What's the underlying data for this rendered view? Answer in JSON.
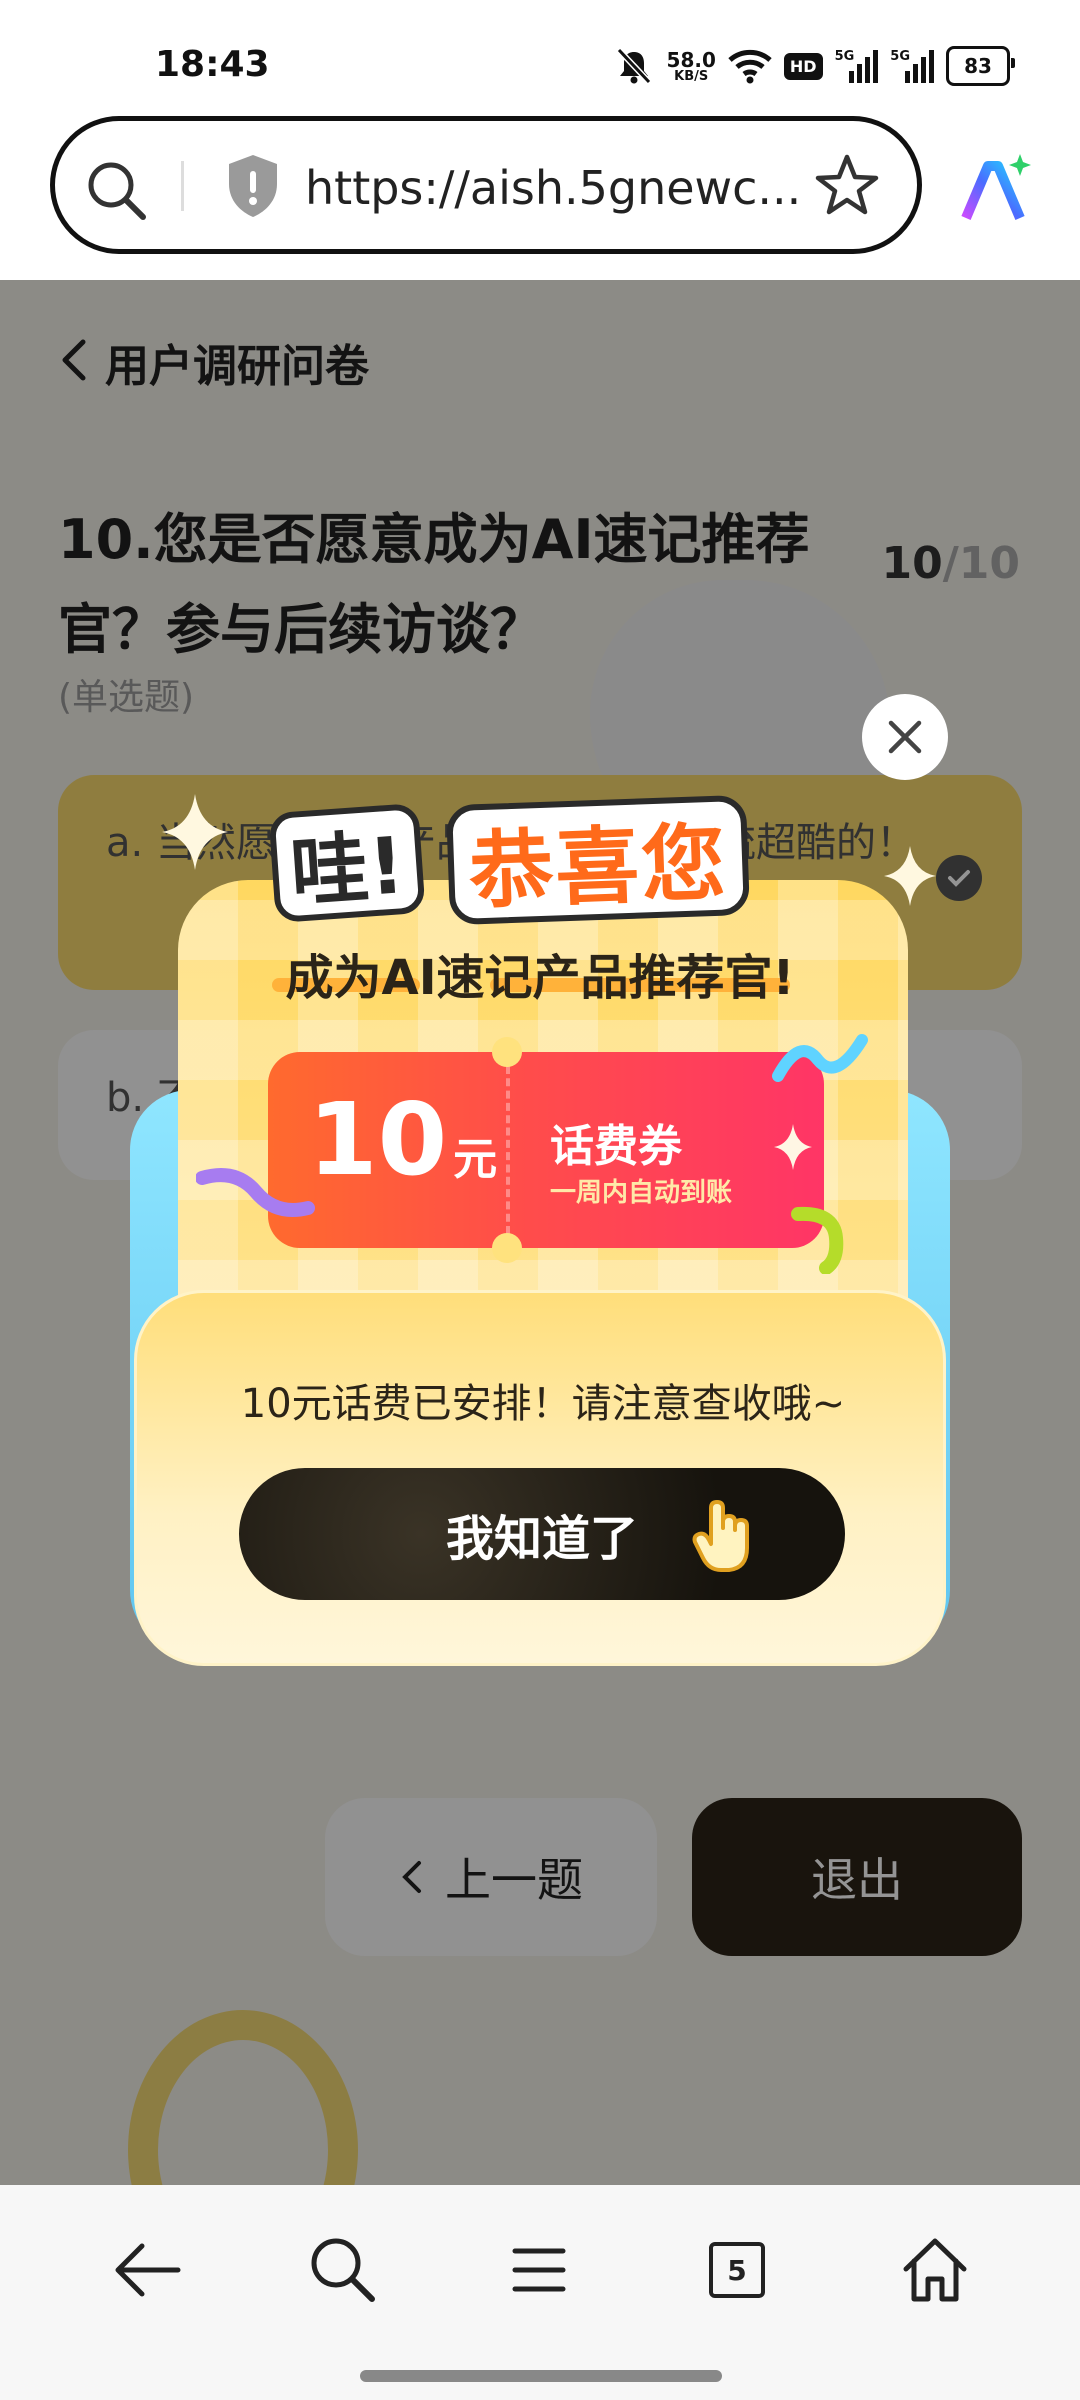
{
  "status_bar": {
    "time": "18:43",
    "net_speed_value": "58.0",
    "net_speed_unit": "KB/S",
    "hd_label": "HD",
    "signal_label_1": "5G",
    "signal_label_2": "5G",
    "battery_level": "83"
  },
  "browser": {
    "url": "https://aish.5gnewc...",
    "icons": [
      "search-icon",
      "shield-icon",
      "star-icon",
      "ai-assistant-icon"
    ]
  },
  "page": {
    "header_title": "用户调研问卷",
    "question_title": "10.您是否愿意成为AI速记推荐官？参与后续访谈？",
    "question_current": "10",
    "question_total": "/10",
    "question_type": "(单选题)",
    "option_a": "a. 当然愿意，和产品经理近距离交流超酷的！",
    "option_b": "b. 不愿意",
    "prev_button": "上一题",
    "exit_button": "退出"
  },
  "modal": {
    "wa_text": "哇!",
    "congrats_text": "恭喜您",
    "subtitle": "成为AI速记产品推荐官!",
    "coupon_amount": "10",
    "coupon_unit": "元",
    "coupon_name": "话费券",
    "coupon_desc": "一周内自动到账",
    "message": "10元话费已安排！请注意查收哦~",
    "confirm_button": "我知道了",
    "colors": {
      "accent_orange": "#ff6a1a",
      "coupon_red": "#ff3566",
      "card_yellow": "#ffd860"
    }
  },
  "bottom_nav": {
    "tab_count": "5",
    "items": [
      "back-arrow-icon",
      "search-icon",
      "menu-icon",
      "tabs-icon",
      "home-icon"
    ]
  }
}
